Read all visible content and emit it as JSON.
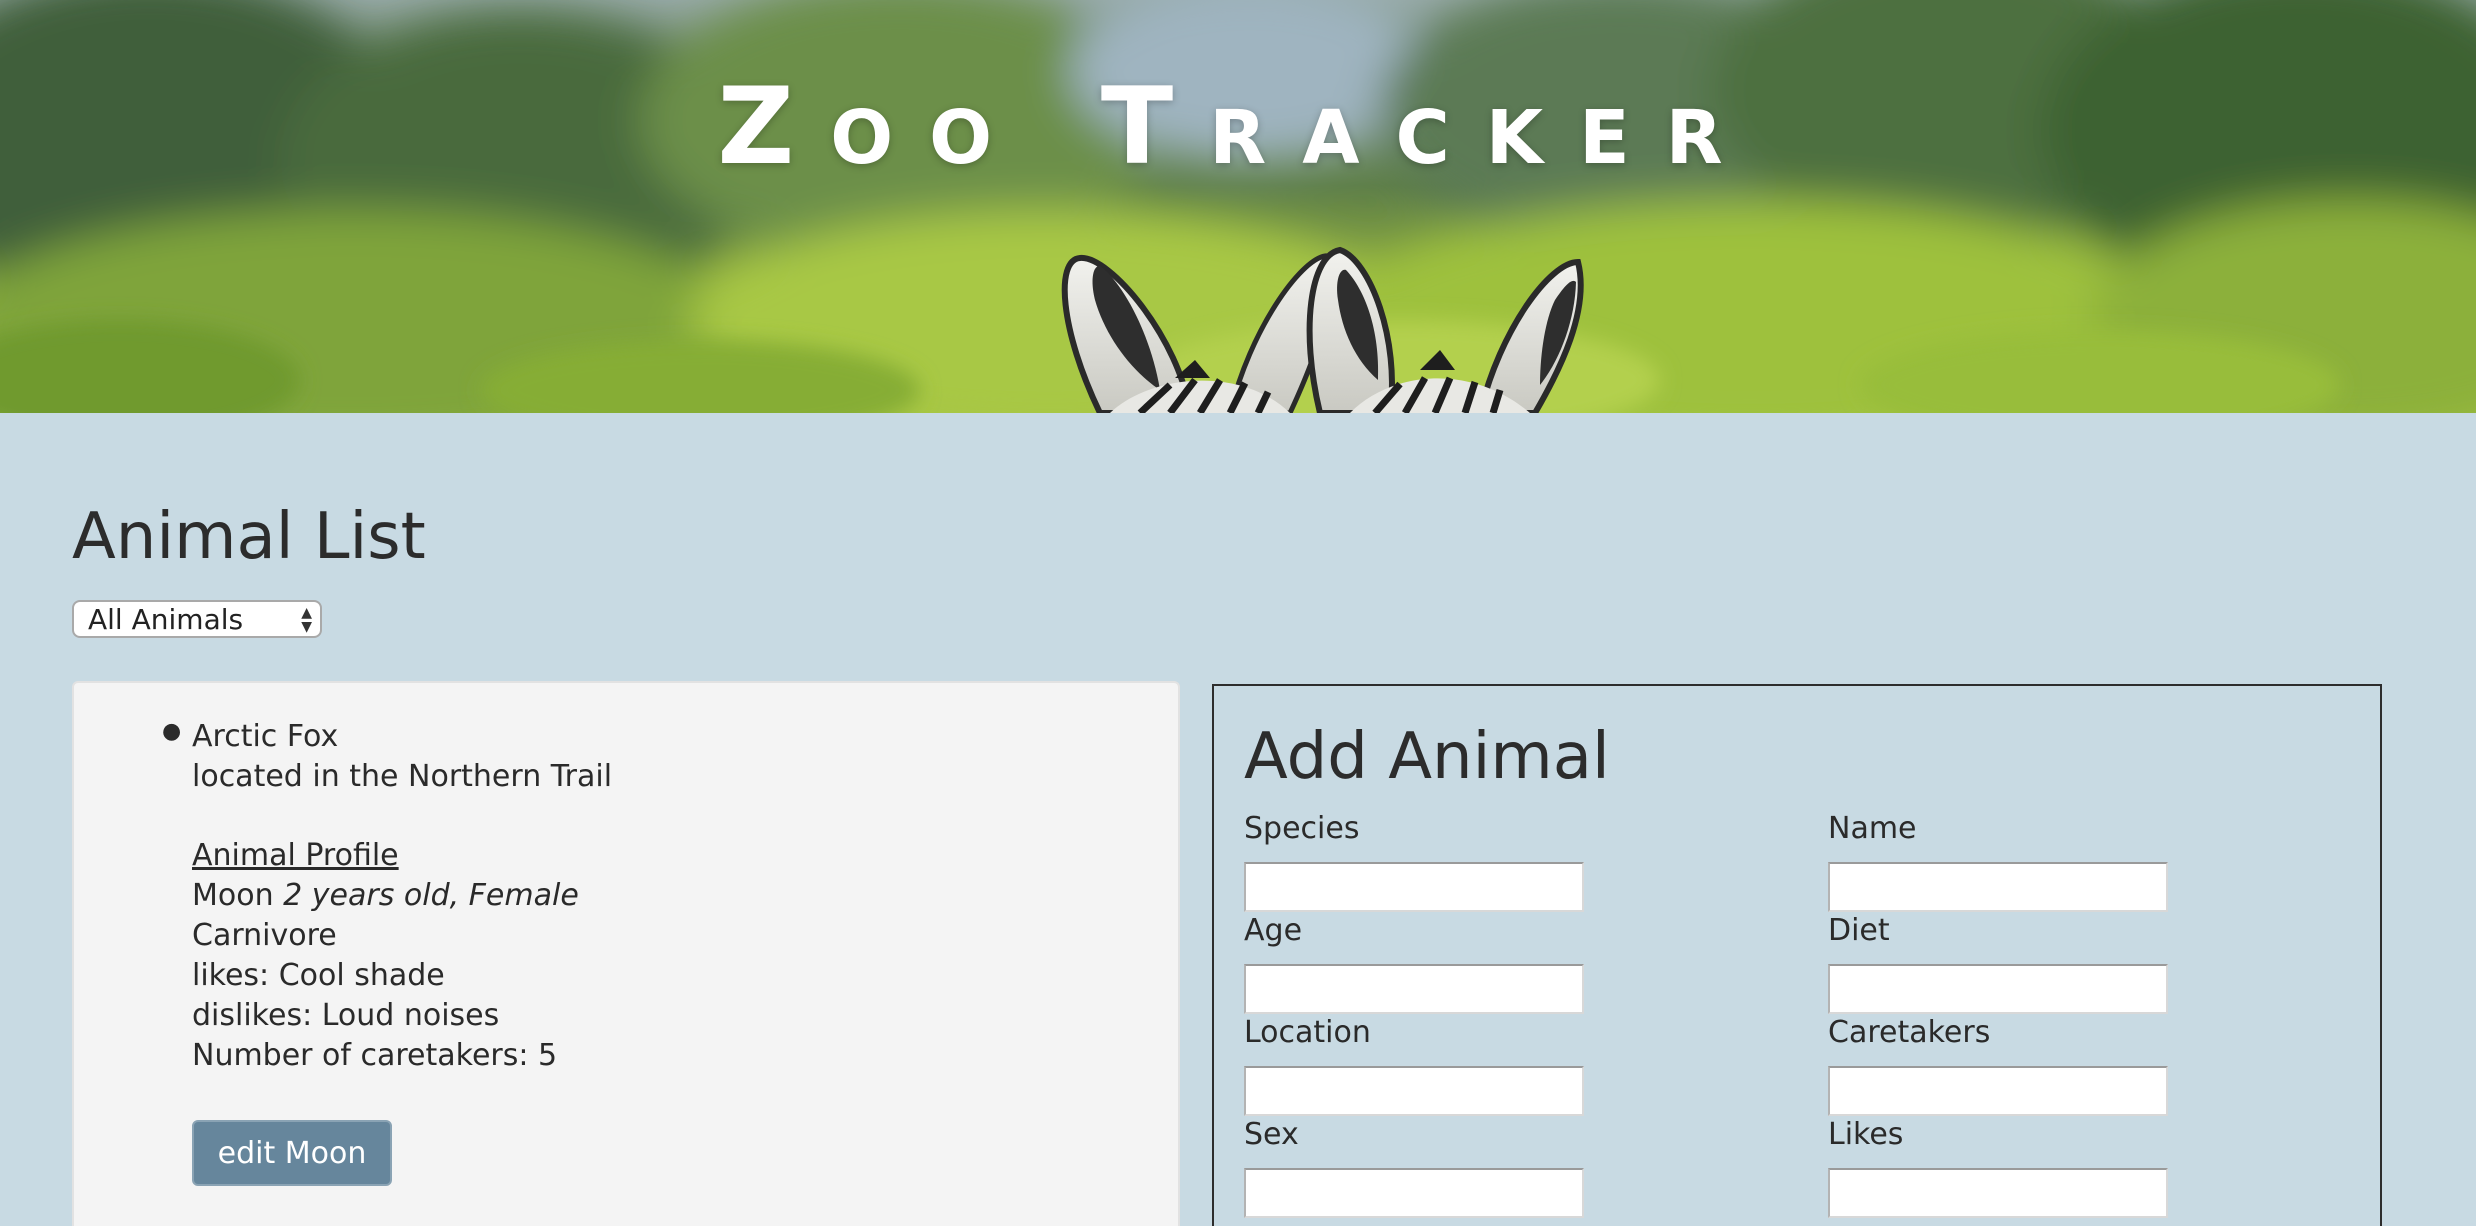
{
  "banner": {
    "title": "Zoo Tracker"
  },
  "animal_list": {
    "heading": "Animal List",
    "filter": {
      "selected": "All Animals"
    },
    "animal": {
      "species": "Arctic Fox",
      "location_text": "located in the Northern Trail",
      "profile_link": "Animal Profile",
      "name": "Moon",
      "age_sex": "2 years old, Female",
      "diet": "Carnivore",
      "likes": "likes: Cool shade",
      "dislikes": "dislikes: Loud noises",
      "caretakers": "Number of caretakers: 5",
      "edit_button": "edit Moon"
    }
  },
  "add_animal": {
    "heading": "Add Animal",
    "fields": {
      "species": "Species",
      "name": "Name",
      "age": "Age",
      "diet": "Diet",
      "location": "Location",
      "caretakers": "Caretakers",
      "sex": "Sex",
      "likes": "Likes"
    }
  },
  "colors": {
    "page_background": "#c8dae3",
    "panel_background": "#f4f4f4",
    "button_background": "#66869c",
    "text": "#2b2b2b"
  }
}
